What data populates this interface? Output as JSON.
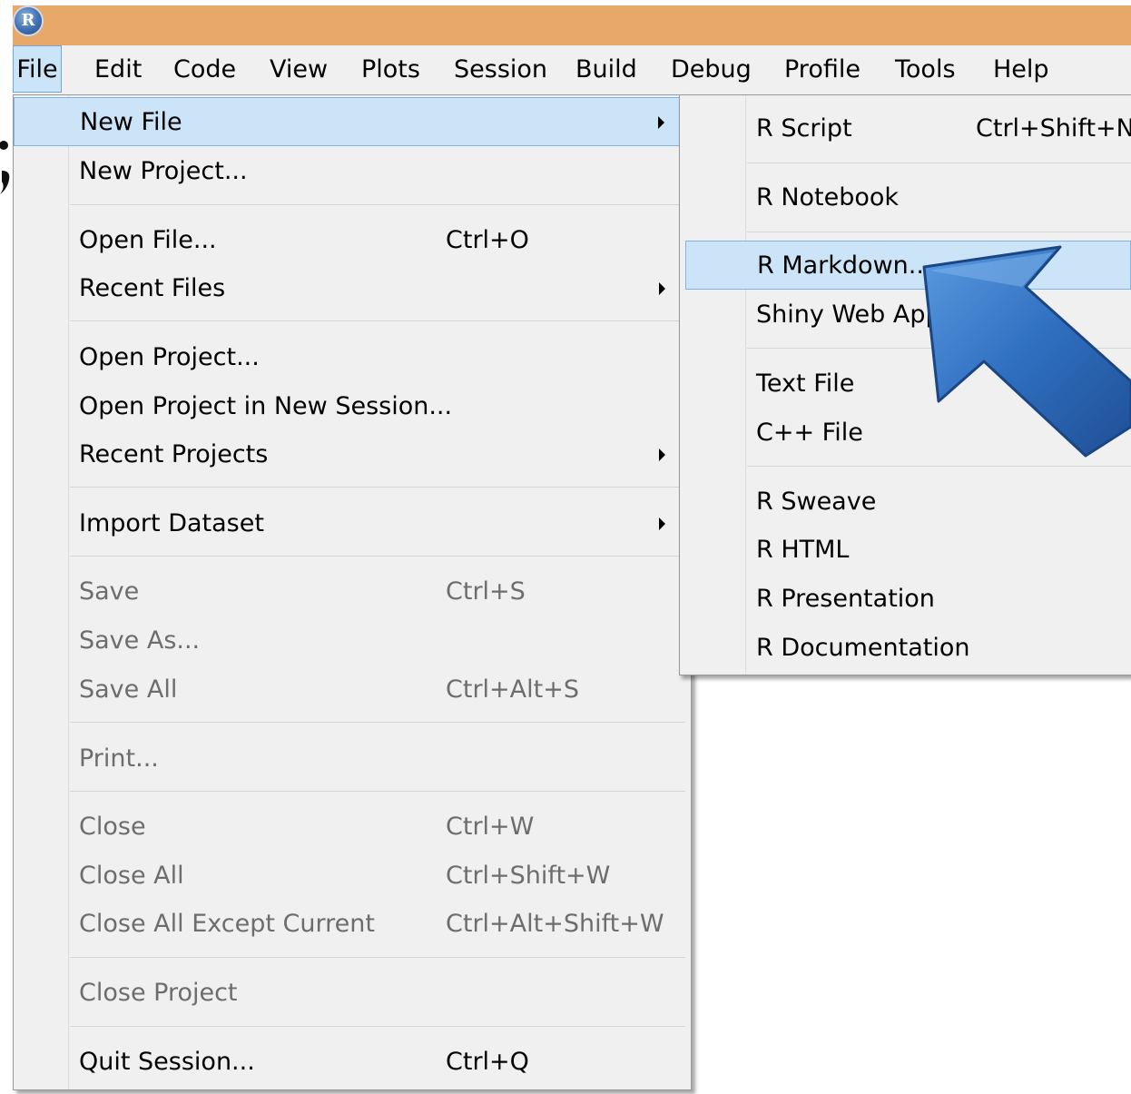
{
  "app": {
    "logo_letter": "R"
  },
  "menubar": {
    "items": [
      "File",
      "Edit",
      "Code",
      "View",
      "Plots",
      "Session",
      "Build",
      "Debug",
      "Profile",
      "Tools",
      "Help"
    ]
  },
  "file_menu": {
    "items": [
      {
        "label": "New File",
        "shortcut": "",
        "submenu": true,
        "highlighted": true,
        "enabled": true
      },
      {
        "label": "New Project...",
        "shortcut": "",
        "submenu": false,
        "enabled": true
      },
      {
        "label": "Open File...",
        "shortcut": "Ctrl+O",
        "submenu": false,
        "enabled": true
      },
      {
        "label": "Recent Files",
        "shortcut": "",
        "submenu": true,
        "enabled": true
      },
      {
        "label": "Open Project...",
        "shortcut": "",
        "submenu": false,
        "enabled": true
      },
      {
        "label": "Open Project in New Session...",
        "shortcut": "",
        "submenu": false,
        "enabled": true
      },
      {
        "label": "Recent Projects",
        "shortcut": "",
        "submenu": true,
        "enabled": true
      },
      {
        "label": "Import Dataset",
        "shortcut": "",
        "submenu": true,
        "enabled": true
      },
      {
        "label": "Save",
        "shortcut": "Ctrl+S",
        "submenu": false,
        "enabled": false
      },
      {
        "label": "Save As...",
        "shortcut": "",
        "submenu": false,
        "enabled": false
      },
      {
        "label": "Save All",
        "shortcut": "Ctrl+Alt+S",
        "submenu": false,
        "enabled": false
      },
      {
        "label": "Print...",
        "shortcut": "",
        "submenu": false,
        "enabled": false
      },
      {
        "label": "Close",
        "shortcut": "Ctrl+W",
        "submenu": false,
        "enabled": false
      },
      {
        "label": "Close All",
        "shortcut": "Ctrl+Shift+W",
        "submenu": false,
        "enabled": false
      },
      {
        "label": "Close All Except Current",
        "shortcut": "Ctrl+Alt+Shift+W",
        "submenu": false,
        "enabled": false
      },
      {
        "label": "Close Project",
        "shortcut": "",
        "submenu": false,
        "enabled": false
      },
      {
        "label": "Quit Session...",
        "shortcut": "Ctrl+Q",
        "submenu": false,
        "enabled": true
      }
    ]
  },
  "new_file_submenu": {
    "items": [
      {
        "label": "R Script",
        "shortcut": "Ctrl+Shift+N"
      },
      {
        "label": "R Notebook",
        "shortcut": ""
      },
      {
        "label": "R Markdown...",
        "shortcut": "",
        "highlighted": true
      },
      {
        "label": "Shiny Web App...",
        "shortcut": ""
      },
      {
        "label": "Text File",
        "shortcut": ""
      },
      {
        "label": "C++ File",
        "shortcut": ""
      },
      {
        "label": "R Sweave",
        "shortcut": ""
      },
      {
        "label": "R HTML",
        "shortcut": ""
      },
      {
        "label": "R Presentation",
        "shortcut": ""
      },
      {
        "label": "R Documentation",
        "shortcut": ""
      }
    ]
  },
  "icons": {
    "logo": "r-logo-icon",
    "submenu_arrow": "chevron-right-icon",
    "pointer": "blue-arrow-icon"
  },
  "colors": {
    "titlebar": "#e8a869",
    "menu_bg": "#f0f0f0",
    "highlight": "#cce4f7",
    "arrow_blue": "#2f6fc0"
  }
}
